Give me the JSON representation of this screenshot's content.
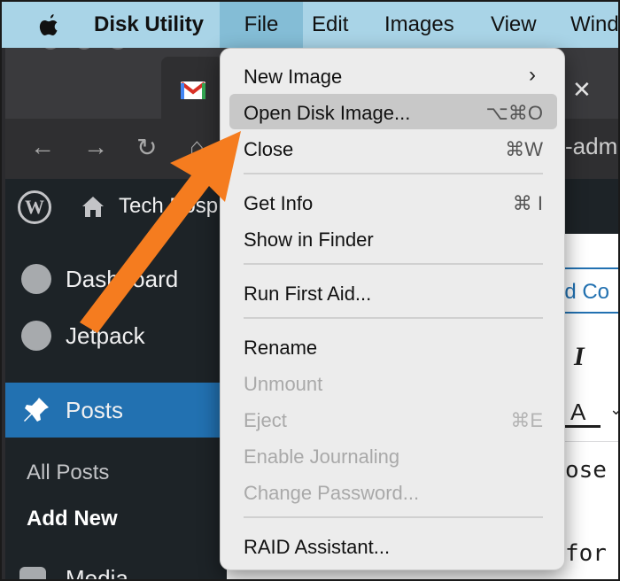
{
  "menubar": {
    "app_name": "Disk Utility",
    "items": [
      "File",
      "Edit",
      "Images",
      "View",
      "Wind"
    ]
  },
  "browser": {
    "url_fragment": "-adm"
  },
  "wordpress": {
    "site_name": "Tech Posp",
    "sidebar": {
      "dashboard": "Dashboard",
      "jetpack": "Jetpack",
      "posts": "Posts",
      "all_posts": "All Posts",
      "add_new": "Add New",
      "media": "Media"
    },
    "editor": {
      "add_co": "ld Co",
      "italic": "I",
      "text_color": "A",
      "frag1": "ose l",
      "frag2": "for a"
    }
  },
  "file_menu": {
    "items": [
      {
        "label": "New Image",
        "shortcut": "",
        "submenu": true
      },
      {
        "label": "Open Disk Image...",
        "shortcut": "⌥⌘O",
        "highlighted": true
      },
      {
        "label": "Close",
        "shortcut": "⌘W"
      },
      {
        "label": "Get Info",
        "shortcut": "⌘ I"
      },
      {
        "label": "Show in Finder",
        "shortcut": ""
      },
      {
        "label": "Run First Aid...",
        "shortcut": ""
      },
      {
        "label": "Rename",
        "shortcut": ""
      },
      {
        "label": "Unmount",
        "shortcut": "",
        "disabled": true
      },
      {
        "label": "Eject",
        "shortcut": "⌘E",
        "disabled": true
      },
      {
        "label": "Enable Journaling",
        "shortcut": "",
        "disabled": true
      },
      {
        "label": "Change Password...",
        "shortcut": "",
        "disabled": true
      },
      {
        "label": "RAID Assistant...",
        "shortcut": ""
      }
    ]
  },
  "colors": {
    "menubar_bg": "#a9d4e7",
    "arrow": "#f57c1f",
    "wp_active": "#2271b1"
  }
}
